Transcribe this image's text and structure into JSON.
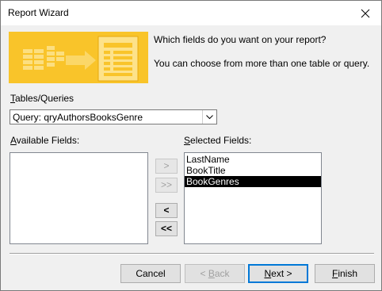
{
  "window": {
    "title": "Report Wizard"
  },
  "header": {
    "prompt_main": "Which fields do you want on your report?",
    "prompt_sub": "You can choose from more than one table or query."
  },
  "tables_queries": {
    "label_accel": "T",
    "label_rest": "ables/Queries",
    "selected": "Query: qryAuthorsBooksGenre"
  },
  "available": {
    "label_accel": "A",
    "label_rest": "vailable Fields:",
    "items": []
  },
  "selected_fields": {
    "label_pre": "",
    "label_accel": "S",
    "label_rest": "elected Fields:",
    "items": [
      {
        "label": "LastName",
        "selected": false
      },
      {
        "label": "BookTitle",
        "selected": false
      },
      {
        "label": "BookGenres",
        "selected": true
      }
    ]
  },
  "move_buttons": {
    "add_one": ">",
    "add_all": ">>",
    "remove_one": "<",
    "remove_all": "<<"
  },
  "footer": {
    "cancel": "Cancel",
    "back_accel": "B",
    "back_pre": "< ",
    "back_rest": "ack",
    "next_accel": "N",
    "next_rest": "ext >",
    "finish_accel": "F",
    "finish_rest": "inish"
  },
  "colors": {
    "banner": "#f9c42a",
    "selection_bg": "#000000",
    "default_button_border": "#0078d7"
  }
}
